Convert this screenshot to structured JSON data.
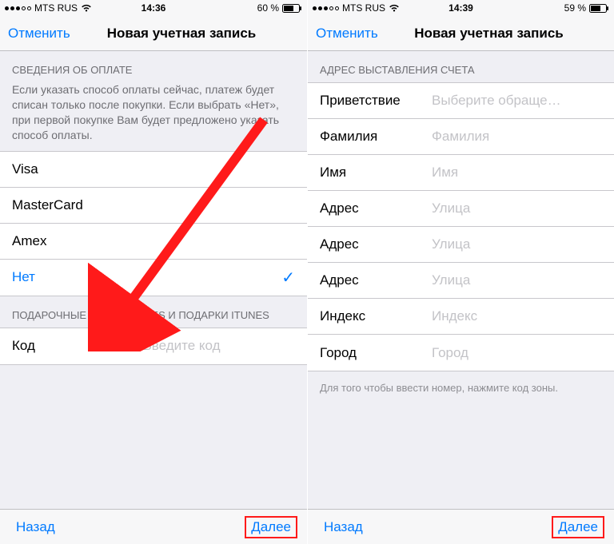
{
  "left": {
    "status": {
      "carrier": "MTS RUS",
      "time": "14:36",
      "battery": "60 %"
    },
    "nav": {
      "cancel": "Отменить",
      "title": "Новая учетная запись"
    },
    "payment": {
      "header": "СВЕДЕНИЯ ОБ ОПЛАТЕ",
      "desc": "Если указать способ оплаты сейчас, платеж будет списан только после покупки. Если выбрать «Нет», при первой покупке Вам будет предложено указать способ оплаты.",
      "options": {
        "visa": "Visa",
        "mastercard": "MasterCard",
        "amex": "Amex",
        "none": "Нет"
      }
    },
    "gift": {
      "header": "ПОДАРОЧНЫЕ КАРТЫ ITUNES И ПОДАРКИ ITUNES",
      "code_label": "Код",
      "code_placeholder": "Введите код"
    },
    "toolbar": {
      "back": "Назад",
      "next": "Далее"
    }
  },
  "right": {
    "status": {
      "carrier": "MTS RUS",
      "time": "14:39",
      "battery": "59 %"
    },
    "nav": {
      "cancel": "Отменить",
      "title": "Новая учетная запись"
    },
    "billing": {
      "header": "АДРЕС ВЫСТАВЛЕНИЯ СЧЕТА",
      "fields": {
        "salutation": {
          "label": "Приветствие",
          "placeholder": "Выберите обраще…"
        },
        "lastname": {
          "label": "Фамилия",
          "placeholder": "Фамилия"
        },
        "firstname": {
          "label": "Имя",
          "placeholder": "Имя"
        },
        "address1": {
          "label": "Адрес",
          "placeholder": "Улица"
        },
        "address2": {
          "label": "Адрес",
          "placeholder": "Улица"
        },
        "address3": {
          "label": "Адрес",
          "placeholder": "Улица"
        },
        "postal": {
          "label": "Индекс",
          "placeholder": "Индекс"
        },
        "city": {
          "label": "Город",
          "placeholder": "Город"
        }
      },
      "footer": "Для того чтобы ввести номер, нажмите код зоны."
    },
    "toolbar": {
      "back": "Назад",
      "next": "Далее"
    }
  }
}
